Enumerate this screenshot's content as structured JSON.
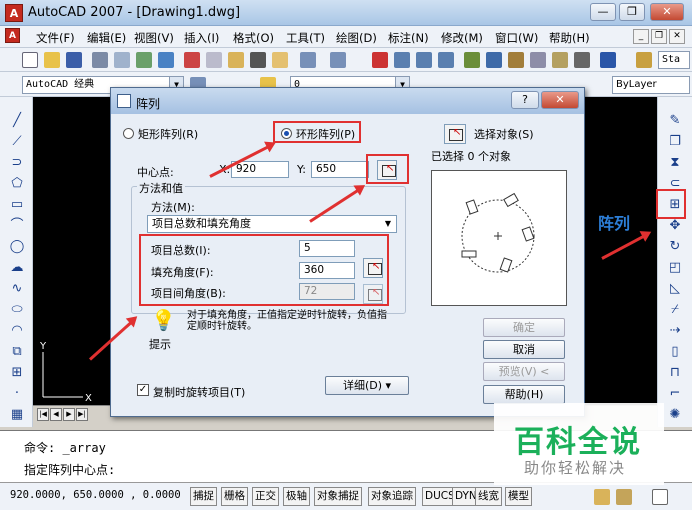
{
  "window": {
    "title": "AutoCAD 2007 - [Drawing1.dwg]",
    "app_badge": "A"
  },
  "menu": {
    "items": [
      "文件(F)",
      "编辑(E)",
      "视图(V)",
      "插入(I)",
      "格式(O)",
      "工具(T)",
      "绘图(D)",
      "标注(N)",
      "修改(M)",
      "窗口(W)",
      "帮助(H)"
    ]
  },
  "toolbar": {
    "workspace": "AutoCAD 经典",
    "layer": "0",
    "bylayer": "ByLayer",
    "style_box": "Sta"
  },
  "dialog": {
    "title": "阵列",
    "rect_array": "矩形阵列(R)",
    "polar_array": "环形阵列(P)",
    "select_objects": "选择对象(S)",
    "selected_count": "已选择 0 个对象",
    "center_label": "中心点:",
    "x_label": "X:",
    "x_value": "920",
    "y_label": "Y:",
    "y_value": "650",
    "method_group": "方法和值",
    "method_label": "方法(M):",
    "method_value": "项目总数和填充角度",
    "total_items_label": "项目总数(I):",
    "total_items_value": "5",
    "fill_angle_label": "填充角度(F):",
    "fill_angle_value": "360",
    "item_angle_label": "项目间角度(B):",
    "item_angle_value": "72",
    "tip_text": "对于填充角度，正值指定逆时针旋转，负值指定顺时针旋转。",
    "tip_label": "提示",
    "rotate_items": "复制时旋转项目(T)",
    "details_button": "详细(D) ▾",
    "ok": "确定",
    "cancel": "取消",
    "preview": "预览(V) <",
    "help": "帮助(H)",
    "help_question": "?"
  },
  "annotation": {
    "array_label": "阵列"
  },
  "command": {
    "line1": "命令: _array",
    "line2": "指定阵列中心点:"
  },
  "status": {
    "coords": "920.0000,  650.0000 , 0.0000",
    "buttons": [
      "捕捉",
      "栅格",
      "正交",
      "极轴",
      "对象捕捉",
      "对象追踪",
      "DUCS",
      "DYN",
      "线宽",
      "模型"
    ]
  },
  "watermark": {
    "logo": "百科全说",
    "sub": "助你轻松解决"
  },
  "colors": {
    "highlight": "#e03030",
    "accent": "#1b4fb0",
    "watermark": "#1bb05a"
  }
}
